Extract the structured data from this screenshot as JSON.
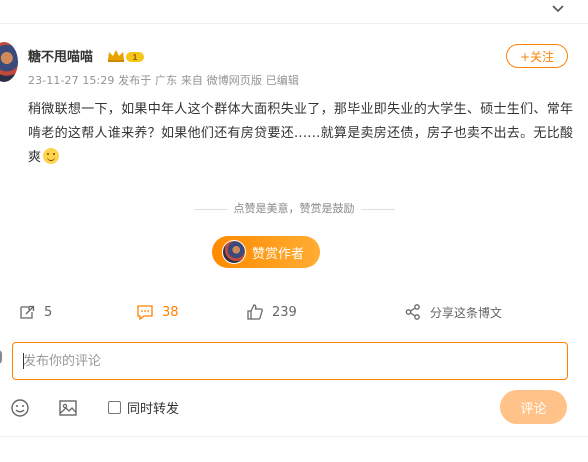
{
  "post": {
    "author_name": "糖不甩喵喵",
    "vip_level": "1",
    "meta": "23-11-27 15:29 发布于 广东  来自 微博网页版 已编辑",
    "follow_label": "+关注",
    "text": "稍微联想一下，如果中年人这个群体大面积失业了，那毕业即失业的大学生、硕士生们、常年啃老的这帮人谁来养？如果他们还有房贷要还......就算是卖房还债，房子也卖不出去。无比酸爽",
    "emoji": "smile-emoji"
  },
  "reward": {
    "hint": "点赞是美意，赞赏是鼓励",
    "button_label": "赞赏作者"
  },
  "actions": {
    "repost_count": "5",
    "comment_count": "38",
    "like_count": "239",
    "share_label": "分享这条博文"
  },
  "comment": {
    "placeholder": "发布你的评论",
    "repost_label": "同时转发",
    "submit_label": "评论"
  },
  "colors": {
    "accent": "#ff8200",
    "submit_disabled": "#ffc38a",
    "meta_text": "#939393"
  },
  "icons": [
    "chevron-down-icon",
    "repost-icon",
    "comment-icon",
    "like-icon",
    "share-icon",
    "emoji-icon",
    "image-icon"
  ]
}
